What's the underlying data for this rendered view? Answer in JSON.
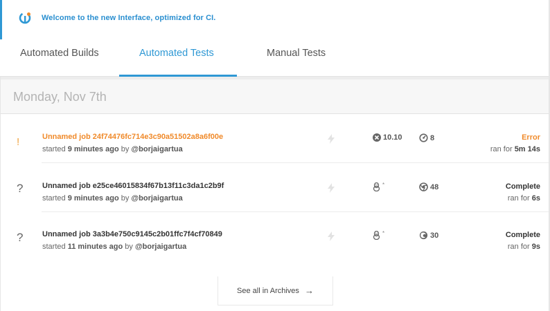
{
  "banner": {
    "text": "Welcome to the new Interface, optimized for CI."
  },
  "tabs": [
    {
      "label": "Automated Builds",
      "active": false
    },
    {
      "label": "Automated Tests",
      "active": true
    },
    {
      "label": "Manual Tests",
      "active": false
    }
  ],
  "date_header": "Monday, Nov 7th",
  "jobs": [
    {
      "status_icon": "!",
      "status": "error",
      "name": "Unnamed job 24f74476fc714e3c90a51502a8a6f00e",
      "started_prefix": "started",
      "started_ago": "9 minutes ago",
      "by_prefix": "by",
      "user": "@borjaigartua",
      "os_icon": "osx-icon",
      "os_version": "10.10",
      "browser_icon": "safari-icon",
      "browser_version": "8",
      "state_label": "Error",
      "ran_prefix": "ran for",
      "duration": "5m 14s"
    },
    {
      "status_icon": "?",
      "status": "complete",
      "name": "Unnamed job e25ce46015834f67b13f11c3da1c2b9f",
      "started_prefix": "started",
      "started_ago": "9 minutes ago",
      "by_prefix": "by",
      "user": "@borjaigartua",
      "os_icon": "linux-icon",
      "os_version": "*",
      "browser_icon": "chrome-icon",
      "browser_version": "48",
      "state_label": "Complete",
      "ran_prefix": "ran for",
      "duration": "6s"
    },
    {
      "status_icon": "?",
      "status": "complete",
      "name": "Unnamed job 3a3b4e750c9145c2b01ffc7f4cf70849",
      "started_prefix": "started",
      "started_ago": "11 minutes ago",
      "by_prefix": "by",
      "user": "@borjaigartua",
      "os_icon": "linux-icon",
      "os_version": "*",
      "browser_icon": "firefox-icon",
      "browser_version": "30",
      "state_label": "Complete",
      "ran_prefix": "ran for",
      "duration": "9s"
    }
  ],
  "archives": {
    "label": "See all in Archives",
    "arrow": "→"
  },
  "colors": {
    "accent": "#2f98d4",
    "error": "#f08a2a",
    "text": "#333333",
    "muted": "#b4b4b4"
  }
}
